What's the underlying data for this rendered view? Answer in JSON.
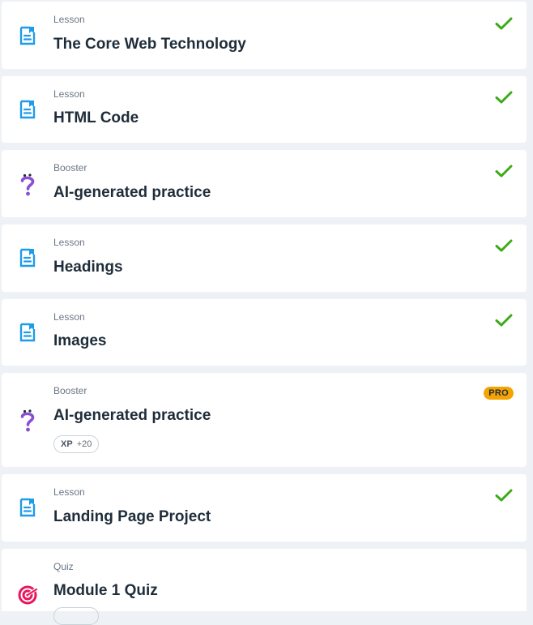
{
  "items": [
    {
      "kind": "Lesson",
      "title": "The Core Web Technology",
      "icon": "lesson-document-icon",
      "status": "completed"
    },
    {
      "kind": "Lesson",
      "title": "HTML Code",
      "icon": "lesson-document-icon",
      "status": "completed"
    },
    {
      "kind": "Booster",
      "title": "AI-generated practice",
      "icon": "question-mark-icon",
      "status": "completed"
    },
    {
      "kind": "Lesson",
      "title": "Headings",
      "icon": "lesson-document-icon",
      "status": "completed"
    },
    {
      "kind": "Lesson",
      "title": "Images",
      "icon": "lesson-document-icon",
      "status": "completed"
    },
    {
      "kind": "Booster",
      "title": "AI-generated practice",
      "icon": "question-mark-icon",
      "status": "pro",
      "badge": "PRO",
      "xp_label": "XP",
      "xp_value": "+20"
    },
    {
      "kind": "Lesson",
      "title": "Landing Page Project",
      "icon": "lesson-document-icon",
      "status": "completed"
    },
    {
      "kind": "Quiz",
      "title": "Module 1 Quiz",
      "icon": "target-icon",
      "status": "none"
    }
  ],
  "colors": {
    "lesson_icon": "#1e9be9",
    "booster_icon": "#8a4fd6",
    "quiz_icon": "#e8175d",
    "check": "#3bab17",
    "pro_badge": "#f5a300"
  }
}
